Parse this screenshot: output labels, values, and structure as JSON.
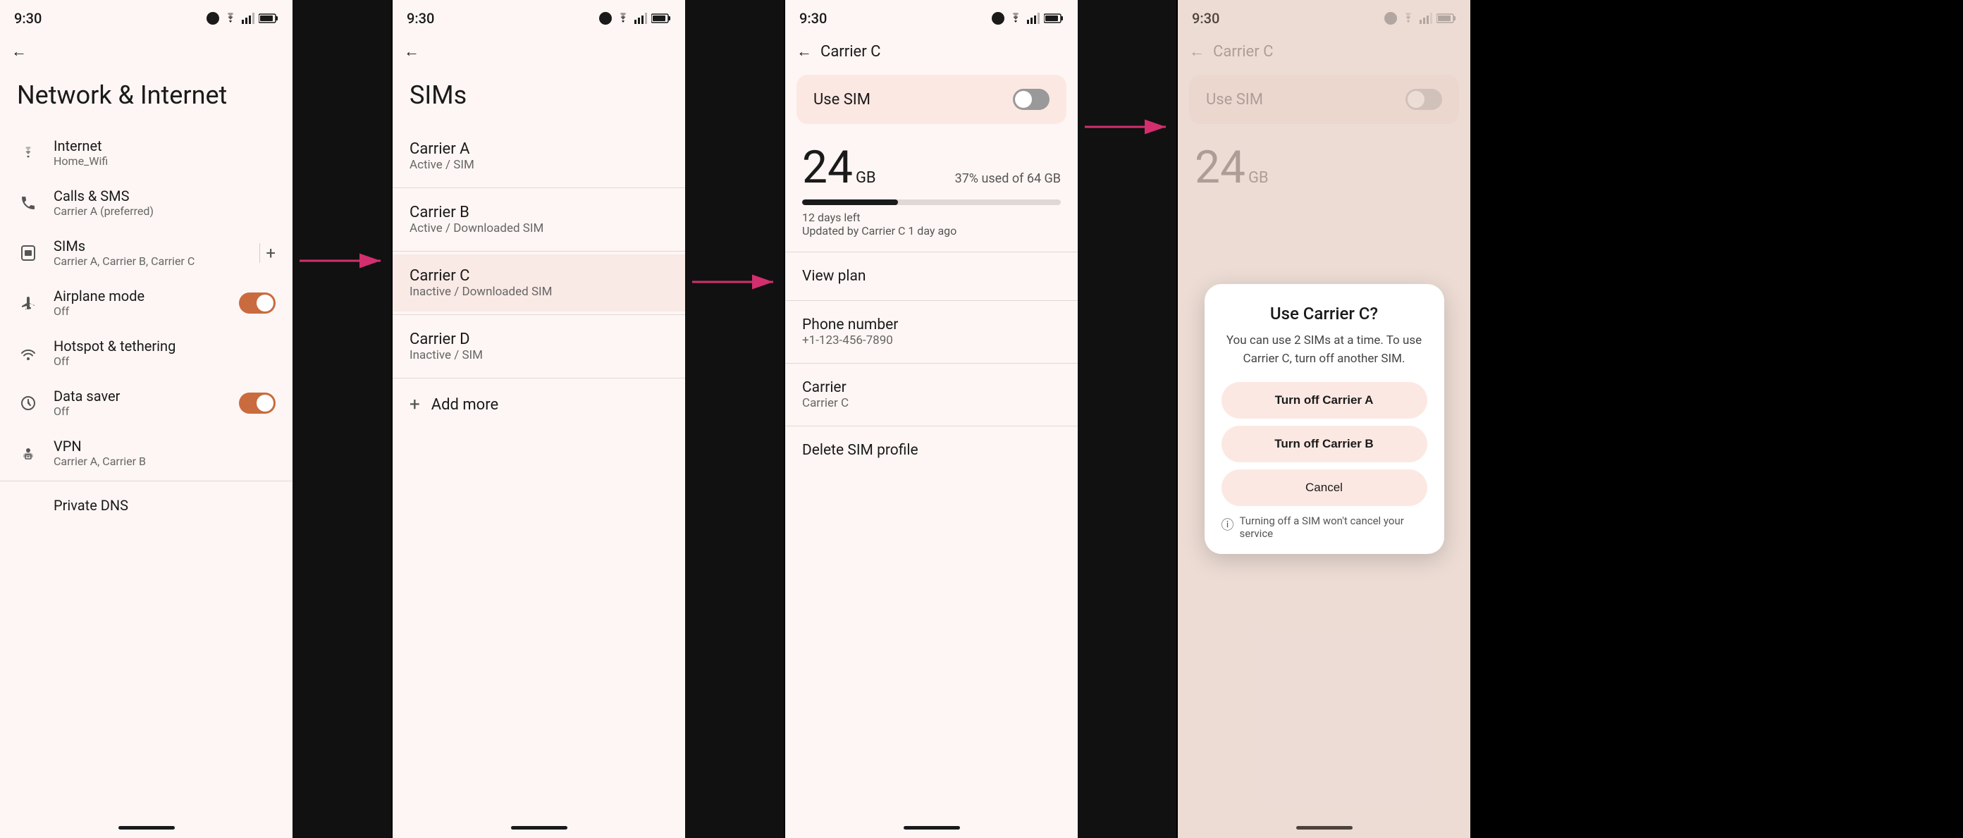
{
  "panels": {
    "panel1": {
      "statusTime": "9:30",
      "title": "Network & Internet",
      "items": [
        {
          "id": "internet",
          "icon": "wifi",
          "label": "Internet",
          "subtitle": "Home_Wifi",
          "hasToggle": false
        },
        {
          "id": "calls-sms",
          "icon": "phone",
          "label": "Calls & SMS",
          "subtitle": "Carrier A (preferred)",
          "hasToggle": false
        },
        {
          "id": "sims",
          "icon": "sim",
          "label": "SIMs",
          "subtitle": "Carrier A, Carrier B, Carrier C",
          "hasToggle": false,
          "hasPlus": true
        },
        {
          "id": "airplane",
          "icon": "airplane",
          "label": "Airplane mode",
          "subtitle": "Off",
          "hasToggle": true,
          "toggleOn": true
        },
        {
          "id": "hotspot",
          "icon": "hotspot",
          "label": "Hotspot & tethering",
          "subtitle": "Off",
          "hasToggle": false
        },
        {
          "id": "datasaver",
          "icon": "datasaver",
          "label": "Data saver",
          "subtitle": "Off",
          "hasToggle": true,
          "toggleOn": true
        },
        {
          "id": "vpn",
          "icon": "vpn",
          "label": "VPN",
          "subtitle": "Carrier A, Carrier B",
          "hasToggle": false
        }
      ],
      "bottomItem": "Private DNS"
    },
    "panel2": {
      "statusTime": "9:30",
      "title": "SIMs",
      "carriers": [
        {
          "name": "Carrier A",
          "status": "Active / SIM",
          "highlighted": false
        },
        {
          "name": "Carrier B",
          "status": "Active / Downloaded SIM",
          "highlighted": false
        },
        {
          "name": "Carrier C",
          "status": "Inactive / Downloaded SIM",
          "highlighted": true
        },
        {
          "name": "Carrier D",
          "status": "Inactive / SIM",
          "highlighted": false
        }
      ],
      "addMore": "Add more"
    },
    "panel3": {
      "statusTime": "9:30",
      "backTitle": "Carrier C",
      "useSim": "Use SIM",
      "dataGB": "24",
      "dataUnit": "GB",
      "dataPercent": "37% used of 64 GB",
      "dataBarFill": 37,
      "daysLeft": "12 days left",
      "updatedBy": "Updated by Carrier C 1 day ago",
      "details": [
        {
          "label": "View plan",
          "value": ""
        },
        {
          "label": "Phone number",
          "value": "+1-123-456-7890"
        },
        {
          "label": "Carrier",
          "value": "Carrier C"
        },
        {
          "label": "Delete SIM profile",
          "value": ""
        }
      ]
    },
    "panel4": {
      "statusTime": "9:30",
      "backTitle": "Carrier C",
      "useSim": "Use SIM",
      "dataGB": "24",
      "dataUnit": "GB",
      "dialog": {
        "title": "Use Carrier C?",
        "body": "You can use 2 SIMs at a time. To use Carrier C, turn off another SIM.",
        "btn1": "Turn off Carrier A",
        "btn2": "Turn off Carrier B",
        "cancel": "Cancel",
        "note": "Turning off a SIM won't cancel your service"
      }
    }
  },
  "arrows": {
    "arrow1": {
      "label": "→"
    },
    "arrow2": {
      "label": "→"
    }
  }
}
